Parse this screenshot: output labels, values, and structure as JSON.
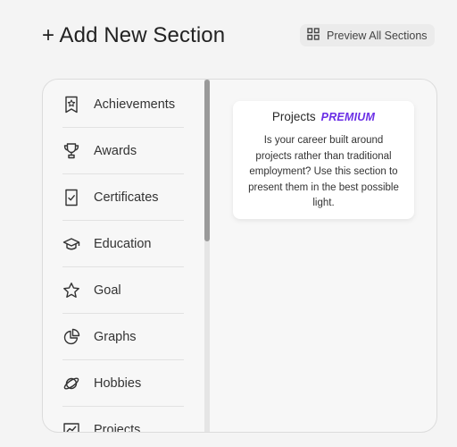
{
  "header": {
    "title": "+ Add New Section",
    "preview_label": "Preview All Sections"
  },
  "sections": [
    {
      "label": "Achievements",
      "icon": "award-badge-icon"
    },
    {
      "label": "Awards",
      "icon": "trophy-icon"
    },
    {
      "label": "Certificates",
      "icon": "certificate-icon"
    },
    {
      "label": "Education",
      "icon": "graduation-cap-icon"
    },
    {
      "label": "Goal",
      "icon": "star-icon"
    },
    {
      "label": "Graphs",
      "icon": "pie-chart-icon"
    },
    {
      "label": "Hobbies",
      "icon": "planet-icon"
    },
    {
      "label": "Projects",
      "icon": "chart-board-icon"
    }
  ],
  "card": {
    "title": "Projects",
    "badge": "PREMIUM",
    "description": "Is your career built around projects rather than traditional employment? Use this section to present them in the best possible light."
  },
  "colors": {
    "accent": "#6b2fe6"
  }
}
